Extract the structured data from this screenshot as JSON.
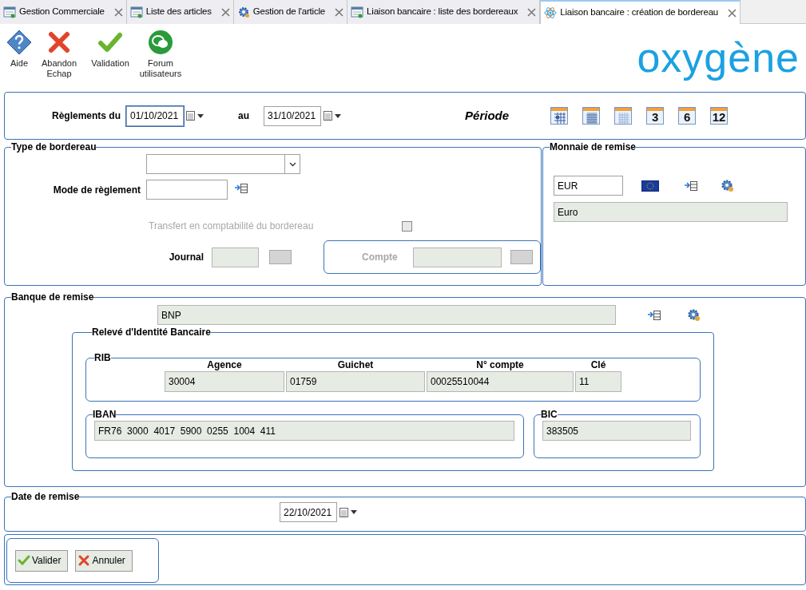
{
  "tabs": [
    {
      "label": "Gestion Commerciale",
      "kind": "table",
      "selected": false
    },
    {
      "label": "Liste des articles",
      "kind": "table",
      "selected": false
    },
    {
      "label": "Gestion de l'article",
      "kind": "gear",
      "selected": false
    },
    {
      "label": "Liaison bancaire : liste des bordereaux",
      "kind": "table",
      "selected": false
    },
    {
      "label": "Liaison bancaire : création de bordereau",
      "kind": "atom",
      "selected": true
    }
  ],
  "toolbar": [
    {
      "kind": "help",
      "lines": [
        "Aide"
      ]
    },
    {
      "kind": "cancel",
      "lines": [
        "Abandon",
        "Echap"
      ]
    },
    {
      "kind": "validate",
      "lines": [
        "Validation"
      ]
    },
    {
      "kind": "forum",
      "lines": [
        "Forum",
        "utilisateurs"
      ]
    }
  ],
  "logo": "oxygène",
  "period": {
    "from_label": "Règlements du",
    "from": {
      "value": "01/10/2021",
      "focused": true
    },
    "to_label": "au",
    "to": {
      "value": "31/10/2021",
      "focused": false
    },
    "title": "Période",
    "presets": [
      {
        "kind": "grid"
      },
      {
        "kind": "dense"
      },
      {
        "kind": "light"
      },
      {
        "kind": "number",
        "text": "3"
      },
      {
        "kind": "number",
        "text": "6"
      },
      {
        "kind": "number",
        "text": "12"
      }
    ]
  },
  "type_bordereau": {
    "title": "Type de bordereau",
    "mode_label": "Mode de règlement",
    "transfer_label": "Transfert en comptabilité du bordereau",
    "transfer_checked": false,
    "journal_label": "Journal",
    "compte_label": "Compte"
  },
  "monnaie": {
    "title": "Monnaie de remise",
    "code": "EUR",
    "name": "Euro"
  },
  "banque": {
    "title": "Banque de remise",
    "name": "BNP",
    "rib_title": "Relevé d'Identité Bancaire",
    "rib": {
      "title": "RIB",
      "columns": [
        "Agence",
        "Guichet",
        "N° compte",
        "Clé"
      ],
      "values": [
        "30004",
        "01759",
        "00025510044",
        "11"
      ]
    },
    "iban_title": "IBAN",
    "iban": "FR76  3000  4017  5900  0255  1004  411",
    "bic_title": "BIC",
    "bic": "383505"
  },
  "date_remise": {
    "title": "Date de remise",
    "value": "22/10/2021"
  },
  "buttons": [
    {
      "kind": "ok",
      "label": "Valider"
    },
    {
      "kind": "cancel",
      "label": "Annuler"
    }
  ]
}
